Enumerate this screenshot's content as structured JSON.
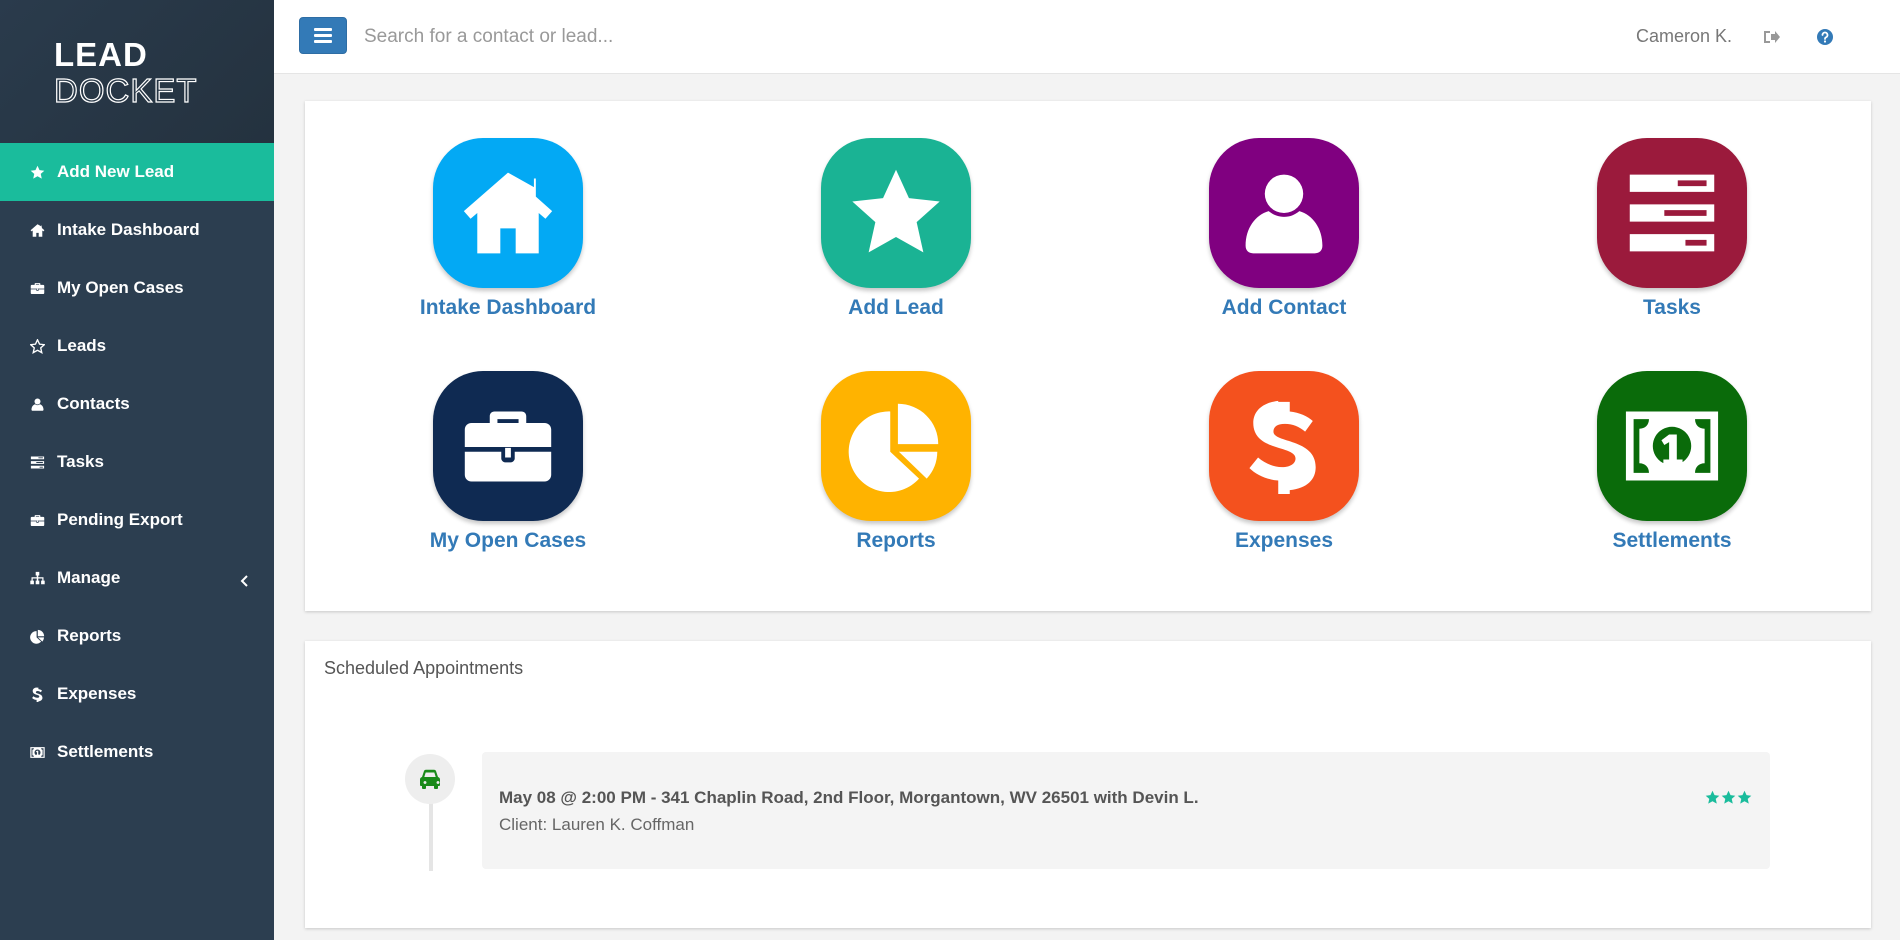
{
  "app": {
    "logo_text_top": "LEAD",
    "logo_text_bottom": "DOCKET"
  },
  "sidebar": {
    "items": [
      {
        "label": "Add New Lead",
        "icon": "star-icon",
        "active": true
      },
      {
        "label": "Intake Dashboard",
        "icon": "home-icon"
      },
      {
        "label": "My Open Cases",
        "icon": "briefcase-icon"
      },
      {
        "label": "Leads",
        "icon": "star-outline-icon"
      },
      {
        "label": "Contacts",
        "icon": "user-icon"
      },
      {
        "label": "Tasks",
        "icon": "tasks-icon"
      },
      {
        "label": "Pending Export",
        "icon": "briefcase-icon"
      },
      {
        "label": "Manage",
        "icon": "sitemap-icon",
        "has_submenu": true
      },
      {
        "label": "Reports",
        "icon": "pie-chart-icon"
      },
      {
        "label": "Expenses",
        "icon": "dollar-icon"
      },
      {
        "label": "Settlements",
        "icon": "money-icon"
      }
    ]
  },
  "topbar": {
    "search_placeholder": "Search for a contact or lead...",
    "user_name": "Cameron K.",
    "signout_icon": "sign-out-icon",
    "help_icon": "question-circle-icon"
  },
  "shortcuts": [
    {
      "label": "Intake Dashboard",
      "icon": "home-icon",
      "color": "#03a9f4"
    },
    {
      "label": "Add Lead",
      "icon": "star-icon",
      "color": "#1ab394"
    },
    {
      "label": "Add Contact",
      "icon": "user-icon",
      "color": "#800080"
    },
    {
      "label": "Tasks",
      "icon": "tasks-icon",
      "color": "#9b1a3c"
    },
    {
      "label": "My Open Cases",
      "icon": "briefcase-icon",
      "color": "#0f2a52"
    },
    {
      "label": "Reports",
      "icon": "pie-chart-icon",
      "color": "#ffb300"
    },
    {
      "label": "Expenses",
      "icon": "dollar-icon",
      "color": "#f4511e"
    },
    {
      "label": "Settlements",
      "icon": "money-icon",
      "color": "#0a6b0a"
    }
  ],
  "appointments": {
    "title": "Scheduled Appointments",
    "items": [
      {
        "main": "May 08 @ 2:00 PM - 341 Chaplin Road, 2nd Floor, Morgantown, WV 26501 with Devin L.",
        "client": "Client: Lauren K. Coffman",
        "icon": "car-icon",
        "rating": 3
      }
    ]
  },
  "colors": {
    "sidebar_bg": "#2c3e50",
    "active_bg": "#1abc9c",
    "link_blue": "#337ab7",
    "star_teal": "#1abc9c",
    "car_green": "#198a19"
  }
}
